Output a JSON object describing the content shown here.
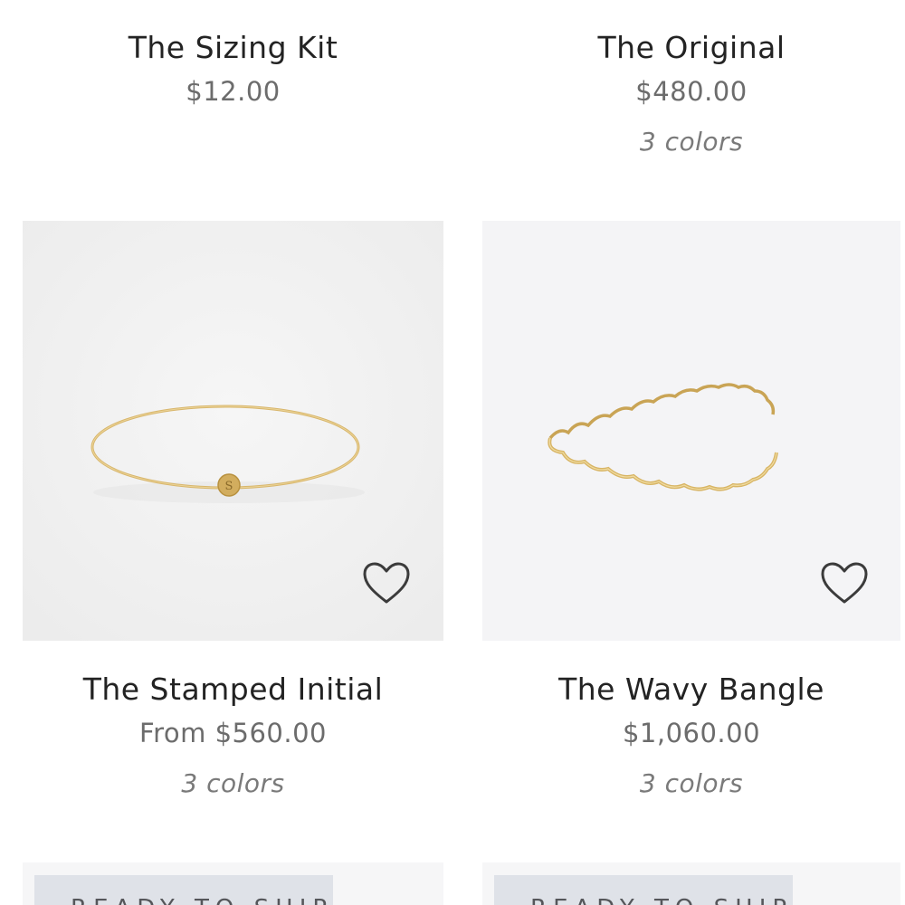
{
  "products": [
    {
      "name": "The Sizing Kit",
      "price": "$12.00"
    },
    {
      "name": "The Original",
      "price": "$480.00",
      "colors": "3 colors"
    },
    {
      "name": "The Stamped Initial",
      "price": "From $560.00",
      "colors": "3 colors",
      "image_icon": "gold-bangle-with-initial-charm",
      "favorite_icon": "heart-outline-icon"
    },
    {
      "name": "The Wavy Bangle",
      "price": "$1,060.00",
      "colors": "3 colors",
      "image_icon": "gold-wavy-bangle",
      "favorite_icon": "heart-outline-icon"
    }
  ],
  "badges": [
    {
      "label": "READY TO SHIP"
    },
    {
      "label": "READY TO SHIP"
    }
  ],
  "colors": {
    "card_background_left": "#f1f1f1",
    "card_background_right": "#f4f4f6",
    "badge_background": "#dfe2e8",
    "gold": "#d6b46a"
  }
}
